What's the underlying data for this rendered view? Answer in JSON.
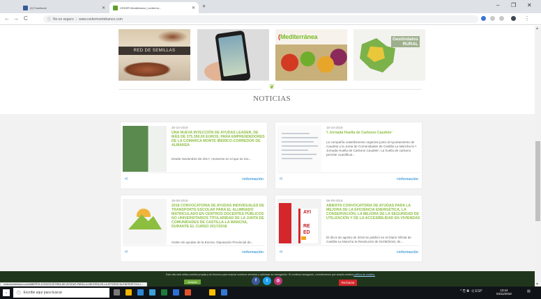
{
  "browser": {
    "tabs": [
      {
        "title": "(2) Facebook",
        "favicon_color": "#3b5998"
      },
      {
        "title": "CEDER Montebanco | cedermo...",
        "favicon_color": "#5f9f2f"
      }
    ],
    "new_tab_symbol": "+",
    "window_controls": {
      "minimize": "–",
      "restore": "❐",
      "close": "✕"
    },
    "nav": {
      "back": "←",
      "forward": "→",
      "reload": "C"
    },
    "address": {
      "security_label": "No es seguro",
      "url": "www.cedermontebanco.com"
    }
  },
  "banners": [
    {
      "name": "red-de-semillas",
      "label": "RED DE SEMILLAS"
    },
    {
      "name": "app-promo",
      "label": ""
    },
    {
      "name": "mediterranea",
      "label": "Mediterránea"
    },
    {
      "name": "gestindatos",
      "label": "Gestindatos\nRURAL"
    }
  ],
  "section": {
    "title": "NOTICIAS",
    "icon": "leaf-icon"
  },
  "news": [
    {
      "date": "30-10-2018",
      "headline": "UNA NUEVA INYECCIÓN DE AYUDAS LEADER, DE MÁS DE 375.350,00 EUROS, PARA EMPRENDEDORES DE LA COMARCA MONTE IBÉRICO-CORREDOR DE ALMANSA",
      "excerpt": "Desde Noviembre de 2017, momento en el que se inic...",
      "more": "+información"
    },
    {
      "date": "15-10-2018",
      "headline": "'I Jornada Huella de Carbono Caudete'",
      "excerpt": "La compañía castellonense organiza junto al Ayuntamiento de Caudete y la Junta de Comunidades de Castilla La Mancha la 'I Jornada Huella de Carbono Caudete'. La huella de carbono permite cuantificar...",
      "more": "+información"
    },
    {
      "date": "28-09-2018",
      "headline": "2018 CONVOCATORIA DE AYUDAS INDIVIDUALES DE TRANSPORTE ESCOLAR PARA EL ALUMNADO MATRICULADO EN CENTROS DOCENTES PÚBLICOS NO UNIVERSITARIOS TITULARIDAD DE LA JUNTA DE COMUNIDADES DE CASTILLA-LA MANCHA, DURANTE EL CURSO 2017/2018",
      "excerpt": "Orden de ayudas de la Excma. Diputación Provincial de...",
      "more": "+información"
    },
    {
      "date": "06-09-2018",
      "headline": "ABIERTA CONVOCATORIA DE AYUDAS PARA LA MEJORA DE LA EFICIENCIA ENERGÉTICA, LA CONSERVACIÓN, LA MEJORA DE LA SEGURIDAD DE UTILIZACIÓN Y DE LA ACCESIBILIDAD EN VIVIENDAS",
      "excerpt": "El día 6 de agosto de 2018 se publicó en el Diario Oficial de Castilla-La Mancha la Resolución de 01/08/2018, de...",
      "more": "+información"
    }
  ],
  "thumb4_letters": [
    "AYI",
    "RE",
    "ED"
  ],
  "cookie": {
    "text": "Este sitio web utiliza cookies propias y de terceros para mejorar nuestros servicios y optimizar su navegación. Si continúa navegando, consideramos que acepta nuestra",
    "link": "política de cookies.",
    "accept": "Aceptar",
    "reject": "Rechazar"
  },
  "social": [
    {
      "name": "facebook",
      "glyph": "f",
      "color": "#3b5998"
    },
    {
      "name": "twitter",
      "glyph": "t",
      "color": "#1da1f2"
    },
    {
      "name": "instagram",
      "glyph": "◎",
      "color": "#c1357d"
    }
  ],
  "status_url": "cedermontebanco.com/ABIERTA-CONVOCATORIA-DE-AYUDAS-PARA-LA-MEJORA-DE-LA-EFICIENCIA-ENERGETICA-L...",
  "taskbar": {
    "search_placeholder": "Escribe aquí para buscar",
    "apps": [
      "#7a7a7a",
      "#f0b400",
      "#2b88d8",
      "#3aa0d8",
      "#1e7a3a",
      "#2d6fd6",
      "#e0522c",
      "#ffbf00",
      "#3478d4"
    ],
    "tray": "^ ⎘ ◉ ◁) ESP",
    "time": "13:44",
    "date": "04/11/2018"
  }
}
